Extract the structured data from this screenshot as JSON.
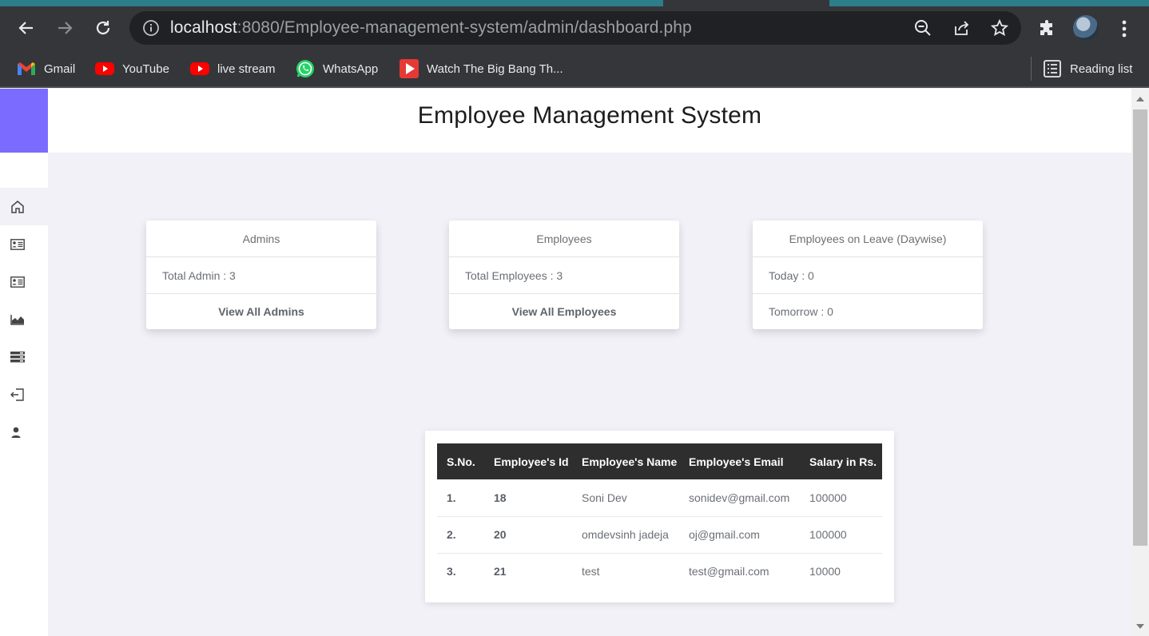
{
  "browser": {
    "url_host": "localhost",
    "url_rest": ":8080/Employee-management-system/admin/dashboard.php",
    "bookmarks": [
      {
        "label": "Gmail",
        "icon": "gmail-icon"
      },
      {
        "label": "YouTube",
        "icon": "youtube-icon"
      },
      {
        "label": "live stream",
        "icon": "youtube-icon"
      },
      {
        "label": "WhatsApp",
        "icon": "whatsapp-icon"
      },
      {
        "label": "Watch The Big Bang Th...",
        "icon": "play-icon"
      }
    ],
    "reading_list": "Reading list"
  },
  "header": {
    "title": "Employee Management System"
  },
  "sidebar": {
    "items": [
      {
        "icon": "home-icon",
        "active": true
      },
      {
        "icon": "id-card-icon"
      },
      {
        "icon": "id-card-icon"
      },
      {
        "icon": "area-chart-icon"
      },
      {
        "icon": "server-icon"
      },
      {
        "icon": "logout-icon"
      },
      {
        "icon": "user-icon"
      }
    ]
  },
  "cards": [
    {
      "title": "Admins",
      "line": "Total Admin : 3",
      "link": "View All Admins"
    },
    {
      "title": "Employees",
      "line": "Total Employees : 3",
      "link": "View All Employees"
    },
    {
      "title": "Employees on Leave (Daywise)",
      "line": "Today : 0",
      "line2": "Tomorrow : 0"
    }
  ],
  "table": {
    "headers": [
      "S.No.",
      "Employee's Id",
      "Employee's Name",
      "Employee's Email",
      "Salary in Rs."
    ],
    "rows": [
      [
        "1.",
        "18",
        "Soni Dev",
        "sonidev@gmail.com",
        "100000"
      ],
      [
        "2.",
        "20",
        "omdevsinh jadeja",
        "oj@gmail.com",
        "100000"
      ],
      [
        "3.",
        "21",
        "test",
        "test@gmail.com",
        "10000"
      ]
    ]
  },
  "colors": {
    "brand": "#7b6cff",
    "table_header": "#2e2e2e",
    "page_bg": "#f2f1f7"
  }
}
